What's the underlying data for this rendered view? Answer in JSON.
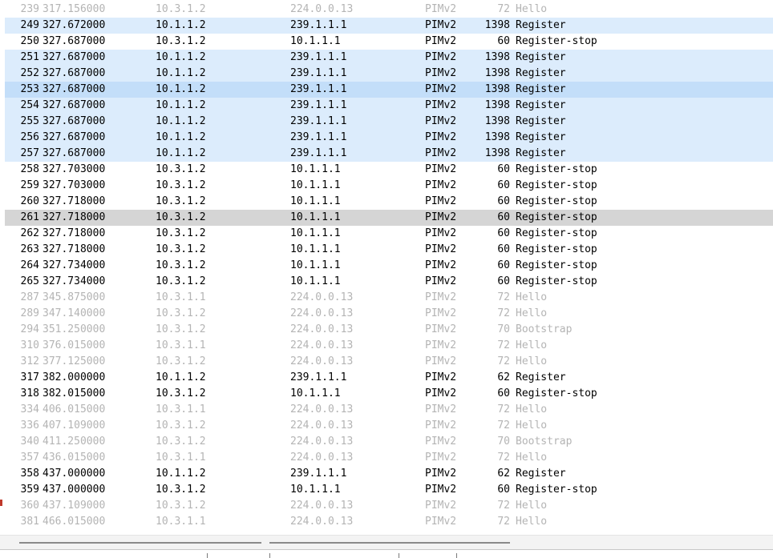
{
  "packets": [
    {
      "no": "239",
      "time": "317.156000",
      "src": "10.3.1.2",
      "dst": "224.0.0.13",
      "proto": "PIMv2",
      "len": "72",
      "info": "Hello",
      "style": "dim"
    },
    {
      "no": "249",
      "time": "327.672000",
      "src": "10.1.1.2",
      "dst": "239.1.1.1",
      "proto": "PIMv2",
      "len": "1398",
      "info": "Register",
      "style": "sel-light"
    },
    {
      "no": "250",
      "time": "327.687000",
      "src": "10.3.1.2",
      "dst": "10.1.1.1",
      "proto": "PIMv2",
      "len": "60",
      "info": "Register-stop",
      "style": ""
    },
    {
      "no": "251",
      "time": "327.687000",
      "src": "10.1.1.2",
      "dst": "239.1.1.1",
      "proto": "PIMv2",
      "len": "1398",
      "info": "Register",
      "style": "sel-light"
    },
    {
      "no": "252",
      "time": "327.687000",
      "src": "10.1.1.2",
      "dst": "239.1.1.1",
      "proto": "PIMv2",
      "len": "1398",
      "info": "Register",
      "style": "sel-light"
    },
    {
      "no": "253",
      "time": "327.687000",
      "src": "10.1.1.2",
      "dst": "239.1.1.1",
      "proto": "PIMv2",
      "len": "1398",
      "info": "Register",
      "style": "sel-mid"
    },
    {
      "no": "254",
      "time": "327.687000",
      "src": "10.1.1.2",
      "dst": "239.1.1.1",
      "proto": "PIMv2",
      "len": "1398",
      "info": "Register",
      "style": "sel-light"
    },
    {
      "no": "255",
      "time": "327.687000",
      "src": "10.1.1.2",
      "dst": "239.1.1.1",
      "proto": "PIMv2",
      "len": "1398",
      "info": "Register",
      "style": "sel-light"
    },
    {
      "no": "256",
      "time": "327.687000",
      "src": "10.1.1.2",
      "dst": "239.1.1.1",
      "proto": "PIMv2",
      "len": "1398",
      "info": "Register",
      "style": "sel-light"
    },
    {
      "no": "257",
      "time": "327.687000",
      "src": "10.1.1.2",
      "dst": "239.1.1.1",
      "proto": "PIMv2",
      "len": "1398",
      "info": "Register",
      "style": "sel-light"
    },
    {
      "no": "258",
      "time": "327.703000",
      "src": "10.3.1.2",
      "dst": "10.1.1.1",
      "proto": "PIMv2",
      "len": "60",
      "info": "Register-stop",
      "style": ""
    },
    {
      "no": "259",
      "time": "327.703000",
      "src": "10.3.1.2",
      "dst": "10.1.1.1",
      "proto": "PIMv2",
      "len": "60",
      "info": "Register-stop",
      "style": ""
    },
    {
      "no": "260",
      "time": "327.718000",
      "src": "10.3.1.2",
      "dst": "10.1.1.1",
      "proto": "PIMv2",
      "len": "60",
      "info": "Register-stop",
      "style": ""
    },
    {
      "no": "261",
      "time": "327.718000",
      "src": "10.3.1.2",
      "dst": "10.1.1.1",
      "proto": "PIMv2",
      "len": "60",
      "info": "Register-stop",
      "style": "gray"
    },
    {
      "no": "262",
      "time": "327.718000",
      "src": "10.3.1.2",
      "dst": "10.1.1.1",
      "proto": "PIMv2",
      "len": "60",
      "info": "Register-stop",
      "style": ""
    },
    {
      "no": "263",
      "time": "327.718000",
      "src": "10.3.1.2",
      "dst": "10.1.1.1",
      "proto": "PIMv2",
      "len": "60",
      "info": "Register-stop",
      "style": ""
    },
    {
      "no": "264",
      "time": "327.734000",
      "src": "10.3.1.2",
      "dst": "10.1.1.1",
      "proto": "PIMv2",
      "len": "60",
      "info": "Register-stop",
      "style": ""
    },
    {
      "no": "265",
      "time": "327.734000",
      "src": "10.3.1.2",
      "dst": "10.1.1.1",
      "proto": "PIMv2",
      "len": "60",
      "info": "Register-stop",
      "style": ""
    },
    {
      "no": "287",
      "time": "345.875000",
      "src": "10.3.1.1",
      "dst": "224.0.0.13",
      "proto": "PIMv2",
      "len": "72",
      "info": "Hello",
      "style": "dim"
    },
    {
      "no": "289",
      "time": "347.140000",
      "src": "10.3.1.2",
      "dst": "224.0.0.13",
      "proto": "PIMv2",
      "len": "72",
      "info": "Hello",
      "style": "dim"
    },
    {
      "no": "294",
      "time": "351.250000",
      "src": "10.3.1.2",
      "dst": "224.0.0.13",
      "proto": "PIMv2",
      "len": "70",
      "info": "Bootstrap",
      "style": "dim"
    },
    {
      "no": "310",
      "time": "376.015000",
      "src": "10.3.1.1",
      "dst": "224.0.0.13",
      "proto": "PIMv2",
      "len": "72",
      "info": "Hello",
      "style": "dim"
    },
    {
      "no": "312",
      "time": "377.125000",
      "src": "10.3.1.2",
      "dst": "224.0.0.13",
      "proto": "PIMv2",
      "len": "72",
      "info": "Hello",
      "style": "dim"
    },
    {
      "no": "317",
      "time": "382.000000",
      "src": "10.1.1.2",
      "dst": "239.1.1.1",
      "proto": "PIMv2",
      "len": "62",
      "info": "Register",
      "style": ""
    },
    {
      "no": "318",
      "time": "382.015000",
      "src": "10.3.1.2",
      "dst": "10.1.1.1",
      "proto": "PIMv2",
      "len": "60",
      "info": "Register-stop",
      "style": ""
    },
    {
      "no": "334",
      "time": "406.015000",
      "src": "10.3.1.1",
      "dst": "224.0.0.13",
      "proto": "PIMv2",
      "len": "72",
      "info": "Hello",
      "style": "dim"
    },
    {
      "no": "336",
      "time": "407.109000",
      "src": "10.3.1.2",
      "dst": "224.0.0.13",
      "proto": "PIMv2",
      "len": "72",
      "info": "Hello",
      "style": "dim"
    },
    {
      "no": "340",
      "time": "411.250000",
      "src": "10.3.1.2",
      "dst": "224.0.0.13",
      "proto": "PIMv2",
      "len": "70",
      "info": "Bootstrap",
      "style": "dim"
    },
    {
      "no": "357",
      "time": "436.015000",
      "src": "10.3.1.1",
      "dst": "224.0.0.13",
      "proto": "PIMv2",
      "len": "72",
      "info": "Hello",
      "style": "dim"
    },
    {
      "no": "358",
      "time": "437.000000",
      "src": "10.1.1.2",
      "dst": "239.1.1.1",
      "proto": "PIMv2",
      "len": "62",
      "info": "Register",
      "style": ""
    },
    {
      "no": "359",
      "time": "437.000000",
      "src": "10.3.1.2",
      "dst": "10.1.1.1",
      "proto": "PIMv2",
      "len": "60",
      "info": "Register-stop",
      "style": ""
    },
    {
      "no": "360",
      "time": "437.109000",
      "src": "10.3.1.2",
      "dst": "224.0.0.13",
      "proto": "PIMv2",
      "len": "72",
      "info": "Hello",
      "style": "dim"
    },
    {
      "no": "381",
      "time": "466.015000",
      "src": "10.3.1.1",
      "dst": "224.0.0.13",
      "proto": "PIMv2",
      "len": "72",
      "info": "Hello",
      "style": "dim"
    }
  ],
  "colors": {
    "selection_light": "#dcecfc",
    "selection_mid": "#c3def9",
    "marked_gray": "#d5d5d5",
    "dim_text": "#b4b4b4"
  }
}
